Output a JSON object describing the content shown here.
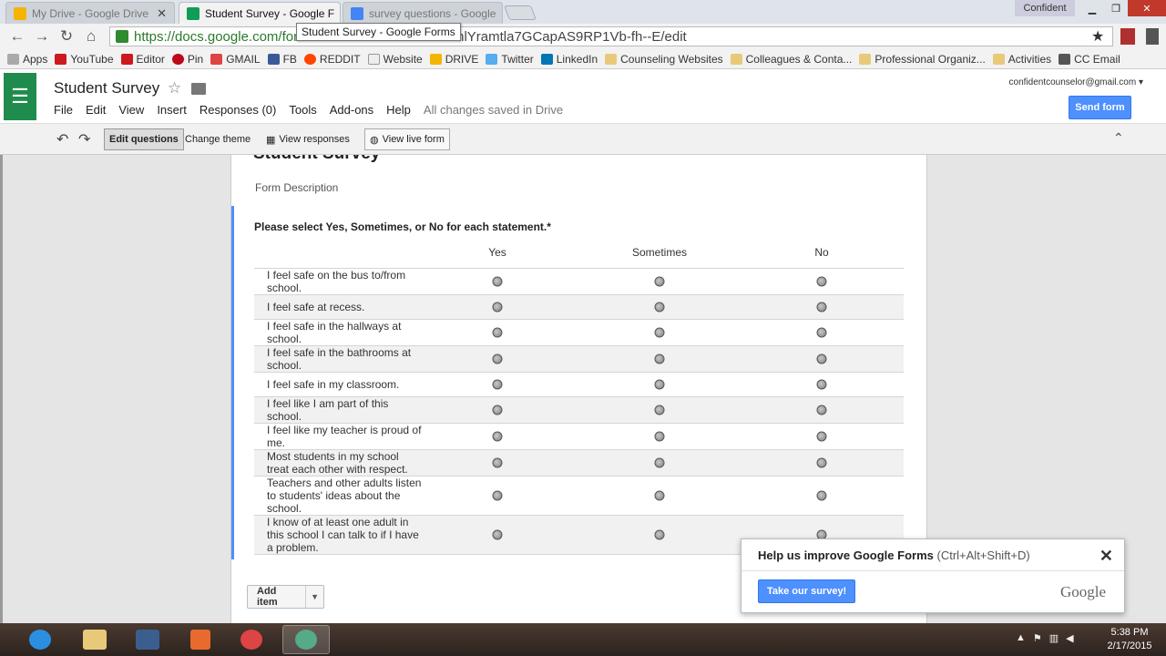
{
  "browser": {
    "tabs": [
      {
        "title": "My Drive - Google Drive",
        "active": false,
        "color": "#f4b400"
      },
      {
        "title": "Student Survey - Google F",
        "active": true,
        "color": "#0f9d58"
      },
      {
        "title": "survey questions - Google",
        "active": false,
        "color": "#4285f4"
      }
    ],
    "profile": "Confident",
    "url_host": "https://docs.google.com/for",
    "url_rest": "hlYramtla7GCapAS9RP1Vb-fh--E/edit",
    "tooltip": "Student Survey - Google Forms",
    "bookmarks": [
      "Apps",
      "YouTube",
      "Editor",
      "Pin",
      "GMAIL",
      "FB",
      "REDDIT",
      "Website",
      "DRIVE",
      "Twitter",
      "LinkedIn",
      "Counseling Websites",
      "Colleagues & Conta...",
      "Professional Organiz...",
      "Activities",
      "CC Email"
    ]
  },
  "app": {
    "title": "Student Survey",
    "menu": [
      "File",
      "Edit",
      "View",
      "Insert",
      "Responses (0)",
      "Tools",
      "Add-ons",
      "Help"
    ],
    "saved_status": "All changes saved in Drive",
    "account": "confidentcounselor@gmail.com",
    "send_form": "Send form",
    "accent_color": "#4d90fe",
    "brand_color": "#1f8c4d"
  },
  "edit_toolbar": {
    "edit_questions": "Edit questions",
    "change_theme": "Change theme",
    "view_responses": "View responses",
    "view_live_form": "View live form"
  },
  "form": {
    "title": "Student Survey",
    "description": "Form Description",
    "question": "Please select Yes, Sometimes, or No for each statement.*",
    "columns": [
      "Yes",
      "Sometimes",
      "No"
    ],
    "rows": [
      "I feel safe on the bus to/from school.",
      "I feel safe at recess.",
      "I feel safe in the hallways at school.",
      "I feel safe in the bathrooms at school.",
      "I feel safe in my classroom.",
      "I feel like I am part of this school.",
      "I feel like my teacher is proud of me.",
      "Most students in my school treat each other with respect.",
      "Teachers and other adults listen to students' ideas about the school.",
      "I know of at least one adult in this school I can talk to if I have a problem."
    ],
    "add_item": "Add item"
  },
  "feedback": {
    "title": "Help us improve Google Forms",
    "shortcut": "(Ctrl+Alt+Shift+D)",
    "button": "Take our survey!",
    "brand": "Google"
  },
  "taskbar": {
    "time": "5:38 PM",
    "date": "2/17/2015"
  }
}
